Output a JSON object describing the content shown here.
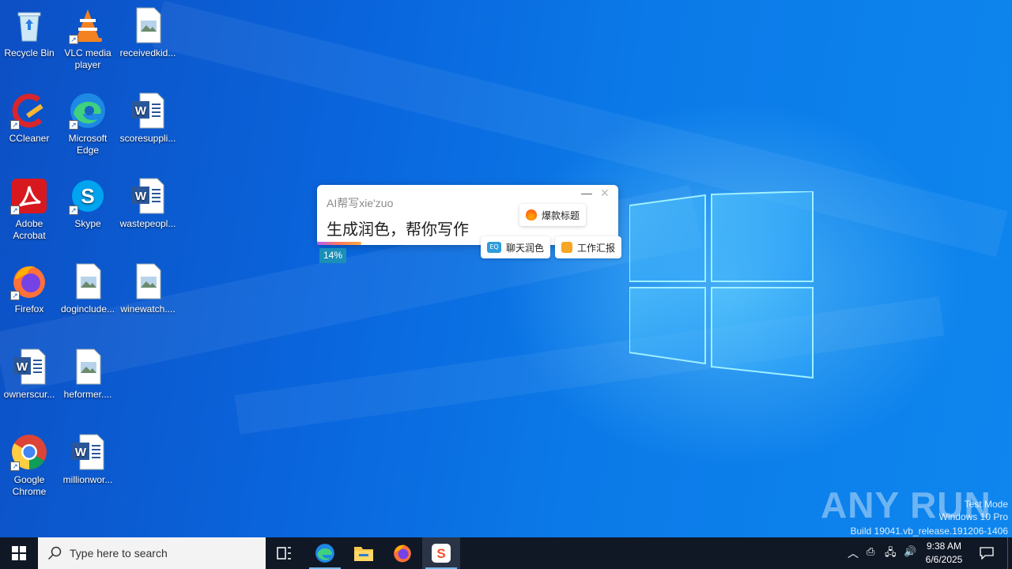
{
  "desktop_icons": [
    {
      "label": "Recycle Bin",
      "icon": "recycle-bin-icon"
    },
    {
      "label": "VLC media player",
      "icon": "vlc-icon"
    },
    {
      "label": "receivedkid...",
      "icon": "image-file-icon"
    },
    {
      "label": "CCleaner",
      "icon": "ccleaner-icon"
    },
    {
      "label": "Microsoft Edge",
      "icon": "edge-icon"
    },
    {
      "label": "scoresuppli...",
      "icon": "word-doc-icon"
    },
    {
      "label": "Adobe Acrobat",
      "icon": "acrobat-icon"
    },
    {
      "label": "Skype",
      "icon": "skype-icon"
    },
    {
      "label": "wastepeopl...",
      "icon": "word-doc-icon"
    },
    {
      "label": "Firefox",
      "icon": "firefox-icon"
    },
    {
      "label": "doginclude...",
      "icon": "image-file-icon"
    },
    {
      "label": "winewatch....",
      "icon": "image-file-icon"
    },
    {
      "label": "ownerscur...",
      "icon": "word-doc-icon"
    },
    {
      "label": "heformer....",
      "icon": "image-file-icon"
    },
    {
      "label": "Google Chrome",
      "icon": "chrome-icon"
    },
    {
      "label": "millionwor...",
      "icon": "word-doc-icon"
    }
  ],
  "popup": {
    "title": "AI帮写xie'zuo",
    "main_text": "生成润色，帮你写作",
    "minimize": "—",
    "close": "✕",
    "progress": "14%",
    "chips": {
      "hot_title": "爆款标题",
      "chat_polish": "聊天润色",
      "work_report": "工作汇报"
    }
  },
  "watermark": {
    "brand": "ANY RUN",
    "line1": "Test Mode",
    "line2": "Windows 10 Pro",
    "line3": "Build 19041.vb_release.191206-1406"
  },
  "taskbar": {
    "search_placeholder": "Type here to search",
    "time": "9:38 AM",
    "date": "6/6/2025"
  },
  "colors": {
    "taskbar_bg": "#101826",
    "accent": "#76b9ed",
    "progress_badge": "#1a8fb8"
  }
}
